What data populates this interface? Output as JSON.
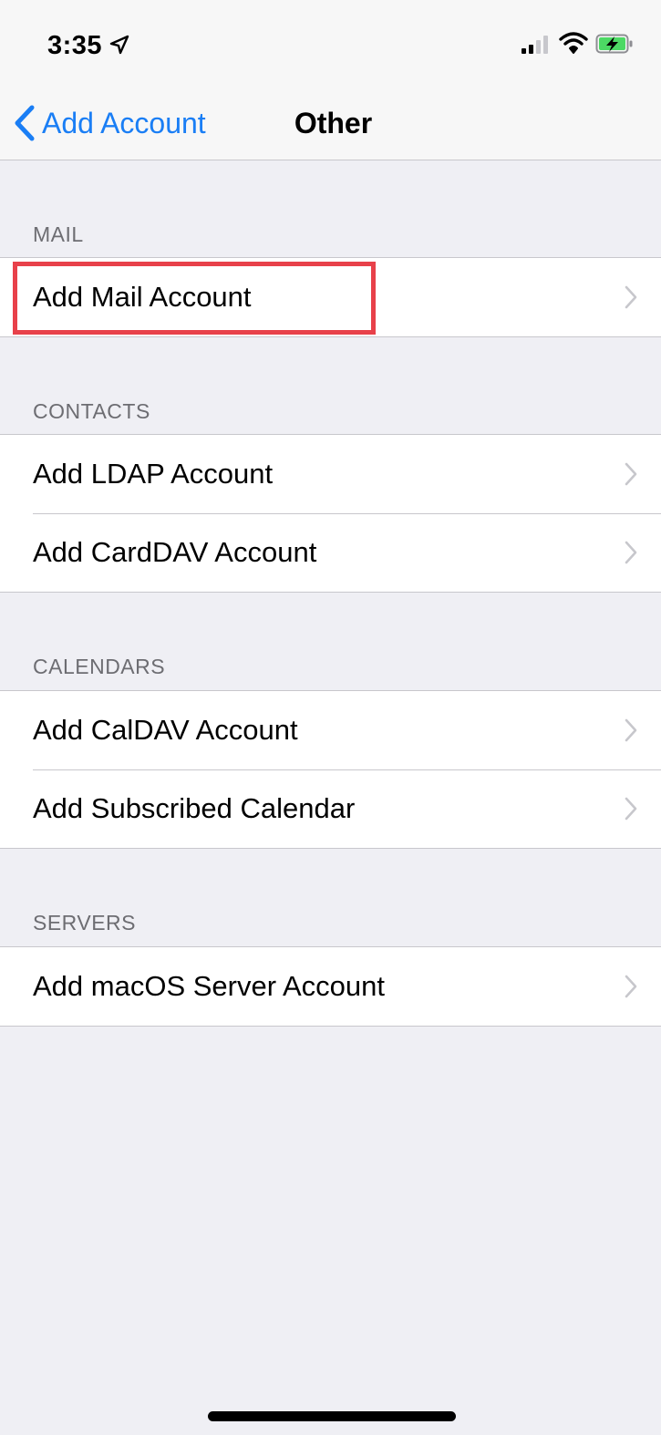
{
  "status_bar": {
    "time": "3:35",
    "icons": [
      "location-arrow-icon",
      "cellular-signal-icon",
      "wifi-icon",
      "battery-charging-icon"
    ]
  },
  "nav": {
    "back_label": "Add Account",
    "title": "Other"
  },
  "sections": [
    {
      "header": "MAIL",
      "rows": [
        "Add Mail Account"
      ]
    },
    {
      "header": "CONTACTS",
      "rows": [
        "Add LDAP Account",
        "Add CardDAV Account"
      ]
    },
    {
      "header": "CALENDARS",
      "rows": [
        "Add CalDAV Account",
        "Add Subscribed Calendar"
      ]
    },
    {
      "header": "SERVERS",
      "rows": [
        "Add macOS Server Account"
      ]
    }
  ],
  "colors": {
    "accent": "#1a7ef5",
    "highlight": "#e8414a",
    "background": "#efeff4",
    "battery_green": "#4cd964"
  }
}
